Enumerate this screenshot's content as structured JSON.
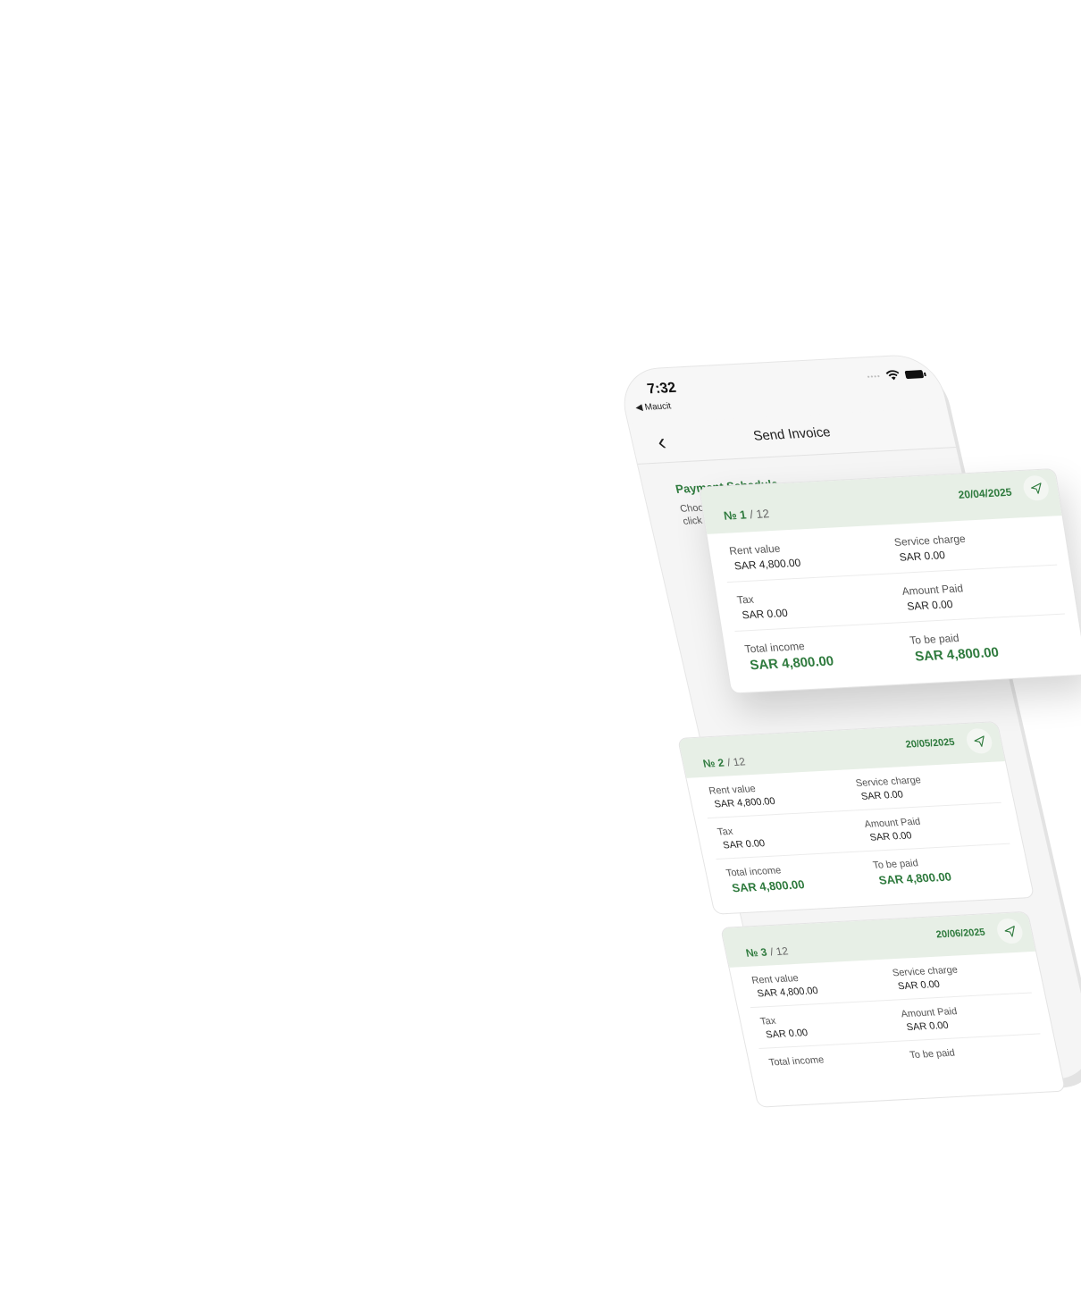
{
  "status_bar": {
    "time": "7:32",
    "back_app": "◀ Maucit",
    "signal": "••••"
  },
  "navbar": {
    "back_icon": "‹",
    "title": "Send Invoice"
  },
  "section": {
    "title": "Payment Schedule",
    "desc": "Choose the pay... and click on th..."
  },
  "cards": [
    {
      "number": "№ 1",
      "total": "/ 12",
      "date": "20/04/2025",
      "rent_label": "Rent value",
      "rent_value": "SAR 4,800.00",
      "service_label": "Service charge",
      "service_value": "SAR 0.00",
      "tax_label": "Tax",
      "tax_value": "SAR 0.00",
      "paid_label": "Amount Paid",
      "paid_value": "SAR 0.00",
      "income_label": "Total income",
      "income_value": "SAR 4,800.00",
      "tobepaid_label": "To be paid",
      "tobepaid_value": "SAR 4,800.00"
    },
    {
      "number": "№ 2",
      "total": "/ 12",
      "date": "20/05/2025",
      "rent_label": "Rent value",
      "rent_value": "SAR 4,800.00",
      "service_label": "Service charge",
      "service_value": "SAR 0.00",
      "tax_label": "Tax",
      "tax_value": "SAR 0.00",
      "paid_label": "Amount Paid",
      "paid_value": "SAR 0.00",
      "income_label": "Total income",
      "income_value": "SAR 4,800.00",
      "tobepaid_label": "To be paid",
      "tobepaid_value": "SAR 4,800.00"
    },
    {
      "number": "№ 3",
      "total": "/ 12",
      "date": "20/06/2025",
      "rent_label": "Rent value",
      "rent_value": "SAR 4,800.00",
      "service_label": "Service charge",
      "service_value": "SAR 0.00",
      "tax_label": "Tax",
      "tax_value": "SAR 0.00",
      "paid_label": "Amount Paid",
      "paid_value": "SAR 0.00",
      "income_label": "Total income",
      "tobepaid_label": "To be paid"
    }
  ],
  "colors": {
    "accent": "#2e7a3d",
    "card_header": "#e7efe6",
    "background": "#ffffff"
  },
  "icons": {
    "send": "send-arrow-icon",
    "wifi": "wifi-icon",
    "battery": "battery-icon"
  }
}
